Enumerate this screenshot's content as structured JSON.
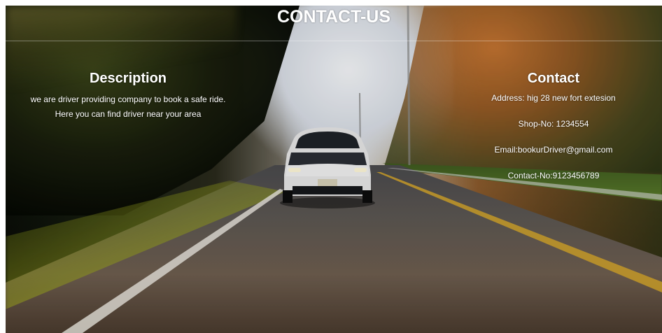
{
  "page": {
    "title": "CONTACT-US"
  },
  "description": {
    "heading": "Description",
    "line1": "we are driver providing company to book a safe ride.",
    "line2": "Here you can find driver near your area"
  },
  "contact": {
    "heading": "Contact",
    "address": "Address: hig 28 new fort extesion",
    "shop": "Shop-No: 1234554",
    "email": "Email:bookurDriver@gmail.com",
    "phone": "Contact-No:9123456789"
  },
  "colors": {
    "text": "#ffffff"
  },
  "background": {
    "icon": "car-road-photo"
  }
}
